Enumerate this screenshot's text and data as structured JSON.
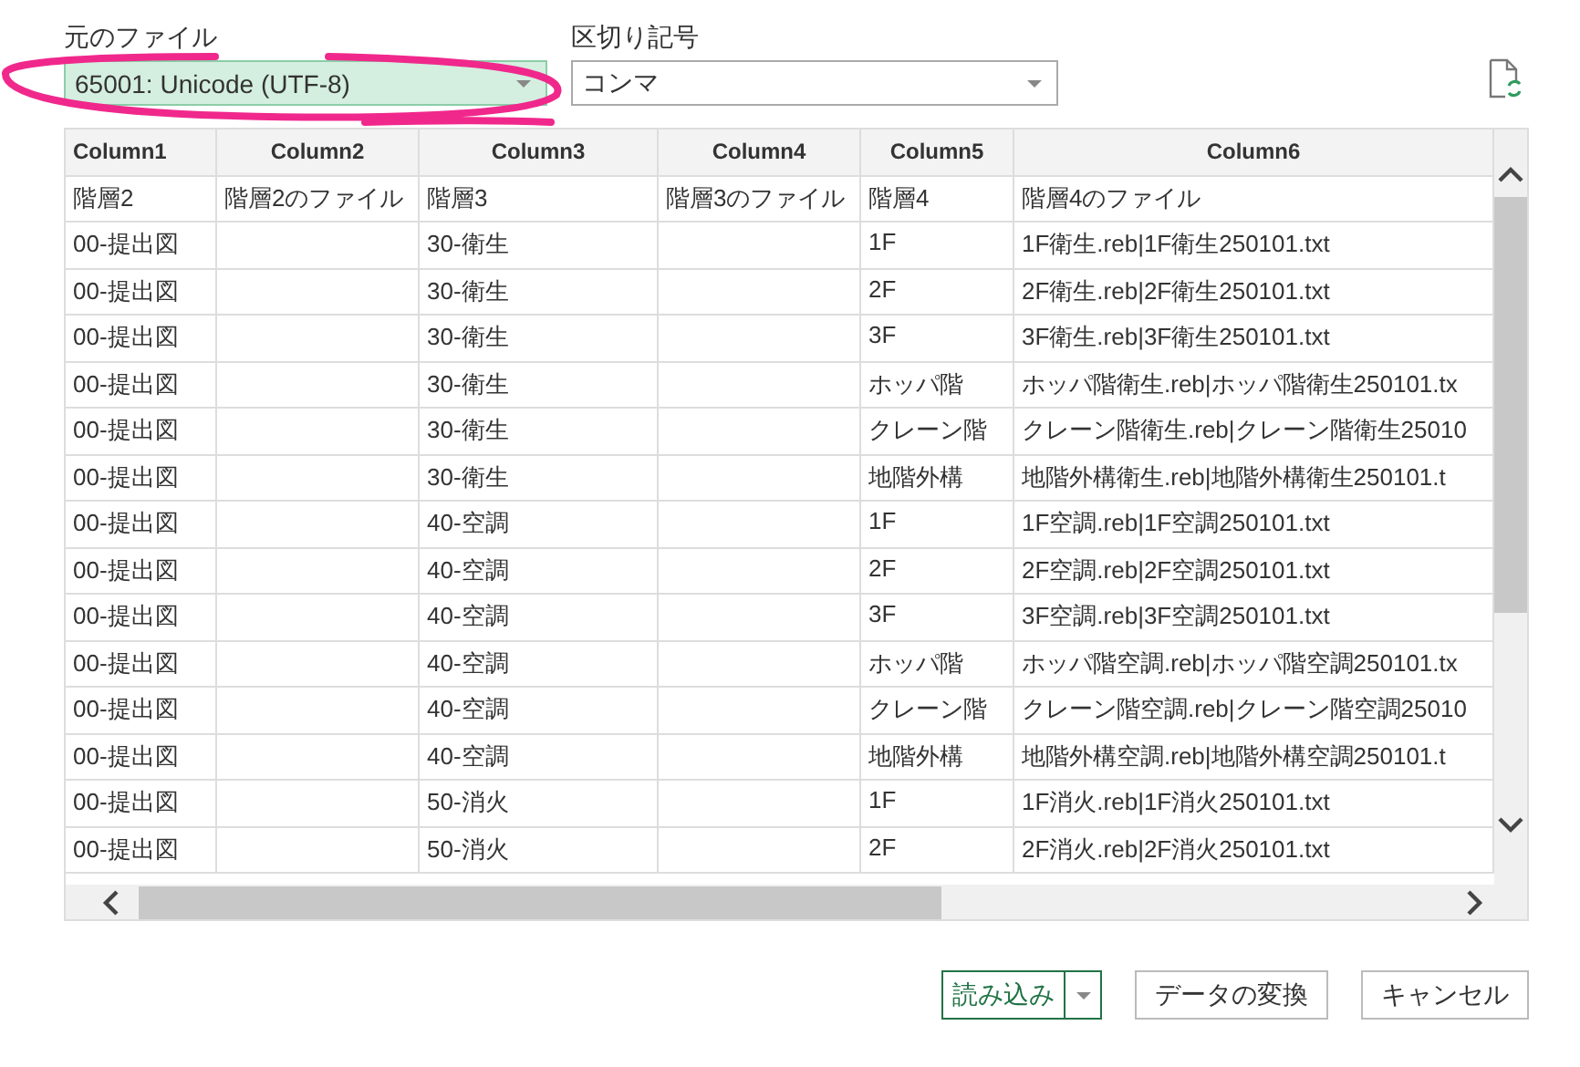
{
  "file_origin": {
    "label": "元のファイル",
    "value": "65001: Unicode (UTF-8)",
    "focused": true
  },
  "delimiter": {
    "label": "区切り記号",
    "value": "コンマ",
    "focused": false
  },
  "table": {
    "columns": [
      "Column1",
      "Column2",
      "Column3",
      "Column4",
      "Column5",
      "Column6"
    ],
    "rows": [
      [
        "階層2",
        "階層2のファイル",
        "階層3",
        "階層3のファイル",
        "階層4",
        "階層4のファイル"
      ],
      [
        "00-提出図",
        "",
        "30-衛生",
        "",
        "1F",
        "1F衛生.reb|1F衛生250101.txt"
      ],
      [
        "00-提出図",
        "",
        "30-衛生",
        "",
        "2F",
        "2F衛生.reb|2F衛生250101.txt"
      ],
      [
        "00-提出図",
        "",
        "30-衛生",
        "",
        "3F",
        "3F衛生.reb|3F衛生250101.txt"
      ],
      [
        "00-提出図",
        "",
        "30-衛生",
        "",
        "ホッパ階",
        "ホッパ階衛生.reb|ホッパ階衛生250101.tx"
      ],
      [
        "00-提出図",
        "",
        "30-衛生",
        "",
        "クレーン階",
        "クレーン階衛生.reb|クレーン階衛生25010"
      ],
      [
        "00-提出図",
        "",
        "30-衛生",
        "",
        "地階外構",
        "地階外構衛生.reb|地階外構衛生250101.t"
      ],
      [
        "00-提出図",
        "",
        "40-空調",
        "",
        "1F",
        "1F空調.reb|1F空調250101.txt"
      ],
      [
        "00-提出図",
        "",
        "40-空調",
        "",
        "2F",
        "2F空調.reb|2F空調250101.txt"
      ],
      [
        "00-提出図",
        "",
        "40-空調",
        "",
        "3F",
        "3F空調.reb|3F空調250101.txt"
      ],
      [
        "00-提出図",
        "",
        "40-空調",
        "",
        "ホッパ階",
        "ホッパ階空調.reb|ホッパ階空調250101.tx"
      ],
      [
        "00-提出図",
        "",
        "40-空調",
        "",
        "クレーン階",
        "クレーン階空調.reb|クレーン階空調25010"
      ],
      [
        "00-提出図",
        "",
        "40-空調",
        "",
        "地階外構",
        "地階外構空調.reb|地階外構空調250101.t"
      ],
      [
        "00-提出図",
        "",
        "50-消火",
        "",
        "1F",
        "1F消火.reb|1F消火250101.txt"
      ],
      [
        "00-提出図",
        "",
        "50-消火",
        "",
        "2F",
        "2F消火.reb|2F消火250101.txt"
      ]
    ]
  },
  "buttons": [
    {
      "label": "読み込み",
      "kind": "split"
    },
    {
      "label": "データの変換",
      "kind": "plain"
    },
    {
      "label": "キャンセル",
      "kind": "plain"
    }
  ]
}
